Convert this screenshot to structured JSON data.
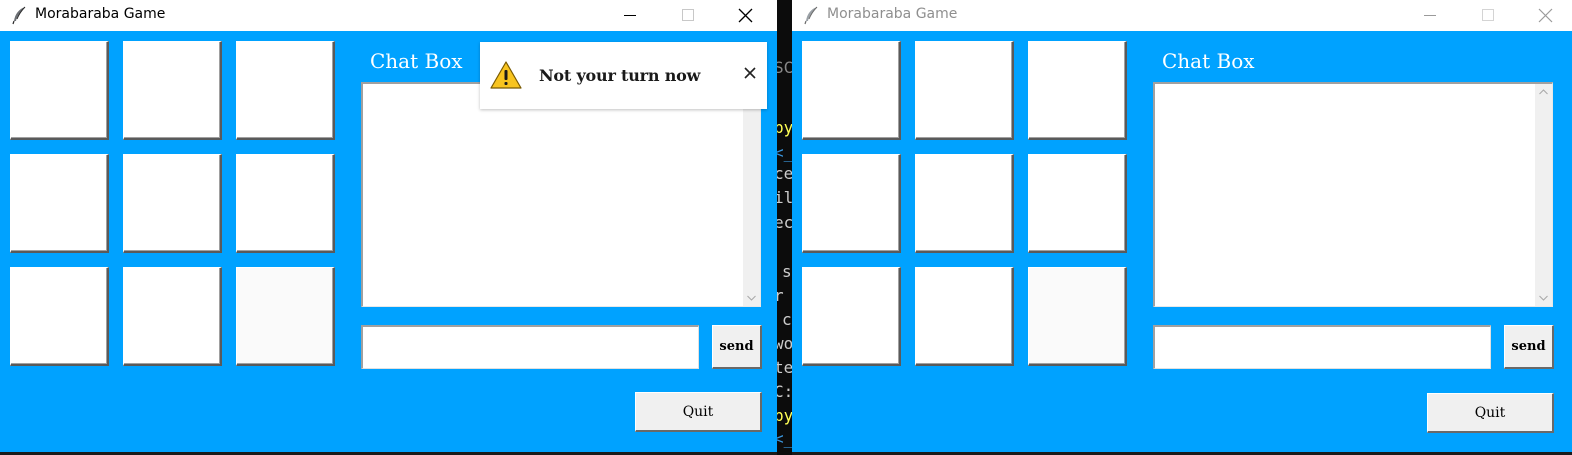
{
  "windows": [
    {
      "title": "Morabaraba Game",
      "chat": {
        "label": "Chat Box",
        "message_value": ""
      },
      "buttons": {
        "send": "send",
        "quit": "Quit"
      }
    },
    {
      "title": "Morabaraba Game",
      "chat": {
        "label": "Chat Box",
        "message_value": ""
      },
      "buttons": {
        "send": "send",
        "quit": "Quit"
      }
    }
  ],
  "toast": {
    "message": "Not your turn now",
    "icon": "warning-icon",
    "close_icon": "close-icon"
  },
  "terminal": {
    "fragments": [
      "SC",
      "py",
      "<_",
      "ce",
      "il",
      "ec",
      "s",
      "r",
      "c",
      "wo",
      "te",
      "C:",
      "py",
      "<_"
    ]
  },
  "colors": {
    "window_bg": "#00a2ff",
    "cell_bg": "#ffffff",
    "button_bg": "#f0f0f0",
    "titlebar_bg": "#ffffff",
    "warning_yellow": "#f8c41f",
    "terminal_prompt": "#ffff55"
  },
  "icons": {
    "app": "feather-icon",
    "minimize": "minimize-icon",
    "maximize": "maximize-icon",
    "close": "close-icon"
  }
}
